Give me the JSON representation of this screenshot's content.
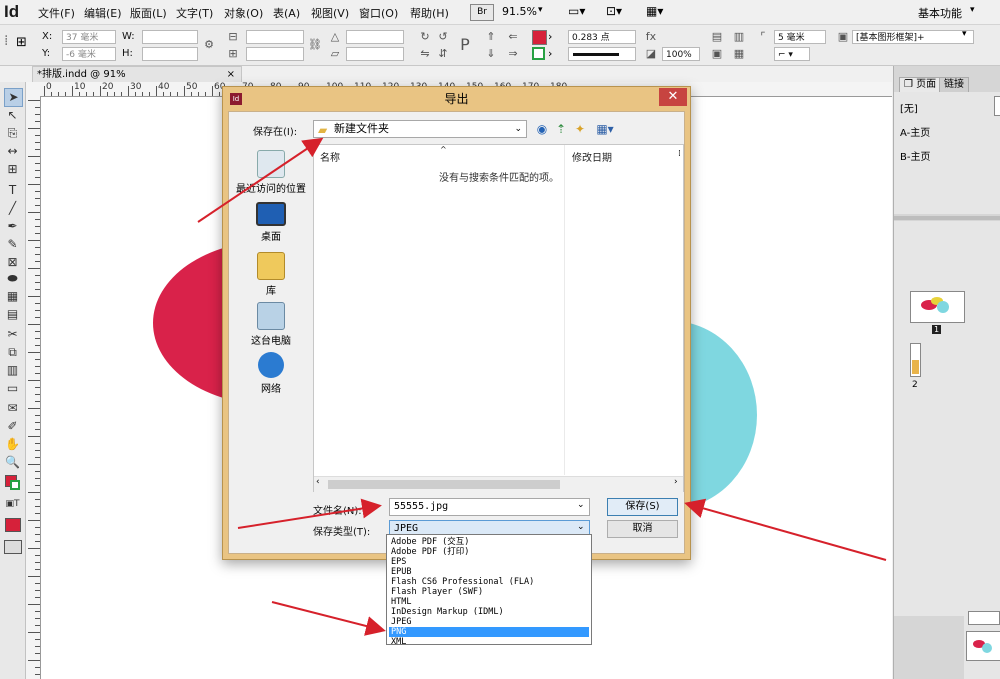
{
  "app": {
    "logo": "Id",
    "menus": [
      "文件(F)",
      "编辑(E)",
      "版面(L)",
      "文字(T)",
      "对象(O)",
      "表(A)",
      "视图(V)",
      "窗口(O)",
      "帮助(H)"
    ],
    "bridge": "Br",
    "zoom": "91.5%",
    "workspace": "基本功能"
  },
  "control": {
    "x_label": "X:",
    "x_value": "37 毫米",
    "y_label": "Y:",
    "y_value": "-6 毫米",
    "w_label": "W:",
    "h_label": "H:",
    "stroke_weight": "0.283 点",
    "percent": "100%",
    "size": "5 毫米",
    "frame_style": "[基本图形框架]+"
  },
  "document": {
    "tab_title": "*排版.indd @ 91%"
  },
  "ruler": {
    "h_labels": [
      "0",
      "10",
      "20",
      "30",
      "40",
      "50",
      "60",
      "70",
      "80",
      "90",
      "100",
      "110",
      "120",
      "130",
      "140",
      "150",
      "160",
      "170",
      "180"
    ]
  },
  "pages_panel": {
    "tab_pages": "页面",
    "tab_links": "链接",
    "none_master": "[无]",
    "master_a": "A-主页",
    "master_b": "B-主页",
    "page1": "1",
    "page2": "2"
  },
  "dialog": {
    "title": "导出",
    "save_in_label": "保存在(I):",
    "save_in_value": "新建文件夹",
    "places": [
      "最近访问的位置",
      "桌面",
      "库",
      "这台电脑",
      "网络"
    ],
    "col_name": "名称",
    "col_modified": "修改日期",
    "empty_message": "没有与搜索条件匹配的项。",
    "filename_label": "文件名(N):",
    "filename_value": "55555.jpg",
    "filetype_label": "保存类型(T):",
    "filetype_value": "JPEG",
    "save_button": "保存(S)",
    "cancel_button": "取消",
    "filetype_options": [
      "Adobe PDF (交互)",
      "Adobe PDF (打印)",
      "EPS",
      "EPUB",
      "Flash CS6 Professional (FLA)",
      "Flash Player (SWF)",
      "HTML",
      "InDesign Markup (IDML)",
      "JPEG",
      "PNG",
      "XML"
    ],
    "selected_option": "PNG"
  },
  "colors": {
    "red_shape": "#d9224a",
    "cyan_shape": "#7fd7e0",
    "arrow": "#d6212b",
    "dialog_frame": "#e9c483",
    "selection": "#3399ff"
  }
}
